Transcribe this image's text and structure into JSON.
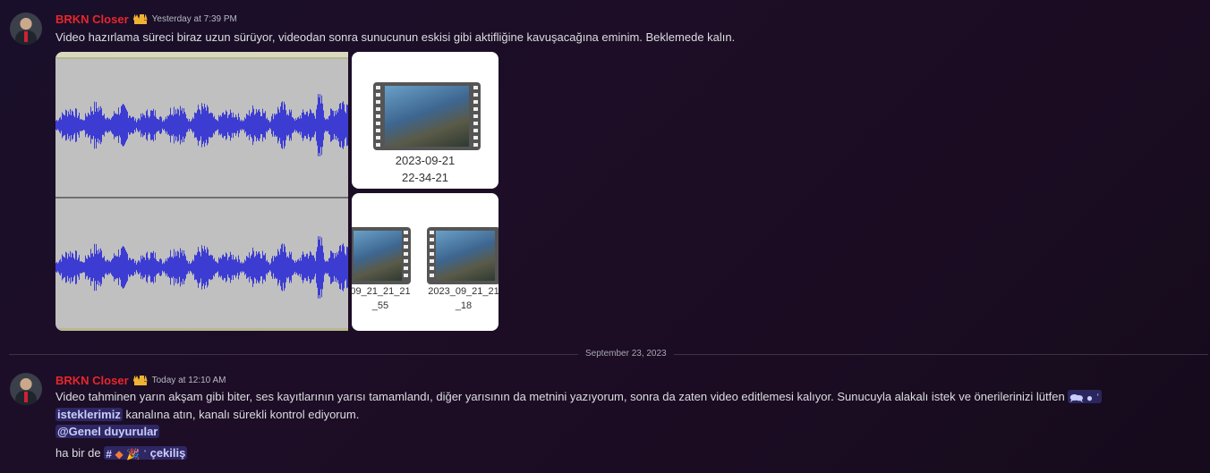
{
  "messages": [
    {
      "author": "BRKN Closer",
      "timestamp": "Yesterday at 7:39 PM",
      "text": "Video hazırlama süreci biraz uzun sürüyor, videodan sonra sunucunun eskisi gibi aktifliğine kavuşacağına eminim. Beklemede kalın.",
      "attachments": [
        {
          "type": "audio-waveform-image"
        },
        {
          "type": "video-file-thumbnail",
          "label_line1": "2023-09-21",
          "label_line2": "22-34-21"
        },
        {
          "type": "video-file-thumbnail",
          "label_line1": "09_21_21_21",
          "label_line2": "_55"
        },
        {
          "type": "video-file-thumbnail",
          "label_line1": "2023_09_21_21",
          "label_line2": "_18"
        }
      ]
    },
    {
      "author": "BRKN Closer",
      "timestamp": "Today at 12:10 AM",
      "line1": "Video tahminen yarın akşam gibi biter, ses kayıtlarının yarısı tamamlandı, diğer yarısının da metnini yazıyorum, sonra da zaten video editlemesi kalıyor. Sunucuyla alakalı istek ve önerilerinizi lütfen",
      "channel1_name": "isteklerimiz",
      "line2_rest": "kanalına atın, kanalı sürekli kontrol ediyorum.",
      "mention": "@Genel duyurular",
      "line4_prefix": "ha bir de",
      "channel2_name": "çekiliş"
    }
  ],
  "date_divider": "September 23, 2023",
  "colors": {
    "author": "#e8262b",
    "mention_bg": "#5865f2",
    "waveform": "#3c3cd2"
  }
}
